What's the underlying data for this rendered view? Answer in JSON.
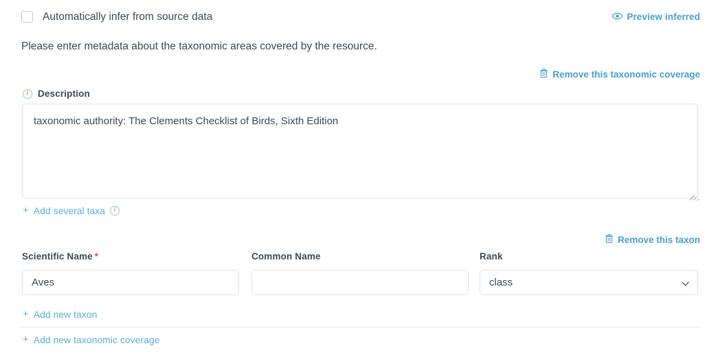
{
  "infer": {
    "checkbox_label": "Automatically infer from source data",
    "checked": false,
    "preview_link": "Preview inferred",
    "preview_icon": "eye-icon"
  },
  "intro": {
    "text": "Please enter metadata about the taxonomic areas covered by the resource."
  },
  "coverage": {
    "remove_link": "Remove this taxonomic coverage",
    "remove_icon": "trash-icon"
  },
  "description": {
    "label": "Description",
    "info_icon": "info-icon",
    "value": "taxonomic authority: The Clements Checklist of Birds, Sixth Edition"
  },
  "add_several_taxa": {
    "label": "Add several taxa",
    "plus": "+",
    "info_icon": "info-icon"
  },
  "taxon": {
    "remove_link": "Remove this taxon",
    "remove_icon": "trash-icon",
    "fields": {
      "scientific_name": {
        "label": "Scientific Name",
        "required_marker": "*",
        "value": "Aves",
        "placeholder": ""
      },
      "common_name": {
        "label": "Common Name",
        "value": "",
        "placeholder": ""
      },
      "rank": {
        "label": "Rank",
        "selected": "class",
        "options": [
          "class"
        ],
        "chevron_icon": "chevron-down-icon"
      }
    }
  },
  "actions": {
    "add_new_taxon": "Add new taxon",
    "add_new_taxonomic_coverage": "Add new taxonomic coverage",
    "plus": "+"
  },
  "colors": {
    "link_blue": "#479fd0",
    "action_blue": "#5bb0dd",
    "text": "#3c4858",
    "required_red": "#e8465f",
    "border": "#dfe3e8",
    "info_green": "#9ecfa2"
  }
}
